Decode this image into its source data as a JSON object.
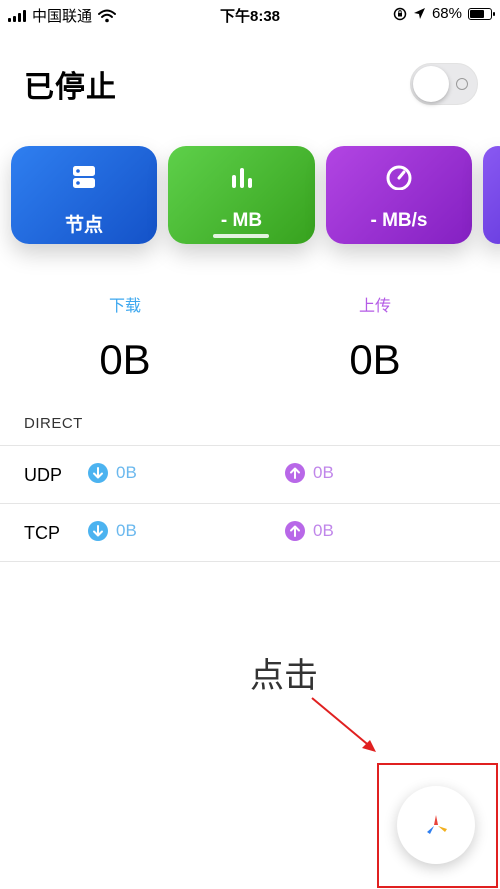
{
  "status_bar": {
    "carrier": "中国联通",
    "time": "下午8:38",
    "battery_percent_text": "68%",
    "battery_level": 0.68
  },
  "header": {
    "title": "已停止",
    "vpn_toggle_on": false
  },
  "cards": {
    "nodes_label": "节点",
    "traffic_label": "- MB",
    "speed_label": "- MB/s",
    "colors": {
      "nodes": "#1f66de",
      "traffic": "#49b834",
      "speed": "#9a2fd2"
    }
  },
  "stats": {
    "download_label": "下载",
    "upload_label": "上传",
    "download_value": "0B",
    "upload_value": "0B"
  },
  "direct": {
    "section_label": "DIRECT",
    "rows": [
      {
        "name": "UDP",
        "download": "0B",
        "upload": "0B"
      },
      {
        "name": "TCP",
        "download": "0B",
        "upload": "0B"
      }
    ]
  },
  "annotation": {
    "hint_text": "点击",
    "highlight_color": "#e02020"
  },
  "icons": {
    "fab": "app-logo-icon",
    "download": "arrow-down-circle-icon",
    "upload": "arrow-up-circle-icon"
  }
}
